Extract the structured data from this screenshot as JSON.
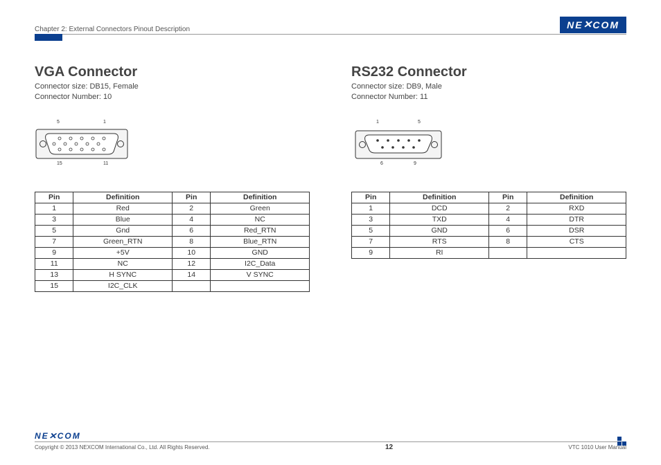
{
  "header": {
    "chapter": "Chapter 2: External Connectors Pinout Description",
    "brand": "NE COM",
    "brand_x": "X"
  },
  "left": {
    "title": "VGA Connector",
    "size": "Connector size: DB15, Female",
    "number": "Connector Number: 10",
    "labels": {
      "tl": "5",
      "tr": "1",
      "bl": "15",
      "br": "11"
    },
    "th": {
      "pin": "Pin",
      "def": "Definition"
    },
    "rows": [
      {
        "p1": "1",
        "d1": "Red",
        "p2": "2",
        "d2": "Green"
      },
      {
        "p1": "3",
        "d1": "Blue",
        "p2": "4",
        "d2": "NC"
      },
      {
        "p1": "5",
        "d1": "Gnd",
        "p2": "6",
        "d2": "Red_RTN"
      },
      {
        "p1": "7",
        "d1": "Green_RTN",
        "p2": "8",
        "d2": "Blue_RTN"
      },
      {
        "p1": "9",
        "d1": "+5V",
        "p2": "10",
        "d2": "GND"
      },
      {
        "p1": "11",
        "d1": "NC",
        "p2": "12",
        "d2": "I2C_Data"
      },
      {
        "p1": "13",
        "d1": "H SYNC",
        "p2": "14",
        "d2": "V SYNC"
      },
      {
        "p1": "15",
        "d1": "I2C_CLK",
        "p2": "",
        "d2": ""
      }
    ]
  },
  "right": {
    "title": "RS232 Connector",
    "size": "Connector size: DB9, Male",
    "number": "Connector Number: 11",
    "labels": {
      "tl": "1",
      "tr": "5",
      "bl": "6",
      "br": "9"
    },
    "th": {
      "pin": "Pin",
      "def": "Definition"
    },
    "rows": [
      {
        "p1": "1",
        "d1": "DCD",
        "p2": "2",
        "d2": "RXD"
      },
      {
        "p1": "3",
        "d1": "TXD",
        "p2": "4",
        "d2": "DTR"
      },
      {
        "p1": "5",
        "d1": "GND",
        "p2": "6",
        "d2": "DSR"
      },
      {
        "p1": "7",
        "d1": "RTS",
        "p2": "8",
        "d2": "CTS"
      },
      {
        "p1": "9",
        "d1": "RI",
        "p2": "",
        "d2": ""
      }
    ]
  },
  "footer": {
    "brand": "NE COM",
    "brand_x": "X",
    "copyright": "Copyright © 2013 NEXCOM International Co., Ltd. All Rights Reserved.",
    "page": "12",
    "manual": "VTC 1010 User Manual"
  }
}
